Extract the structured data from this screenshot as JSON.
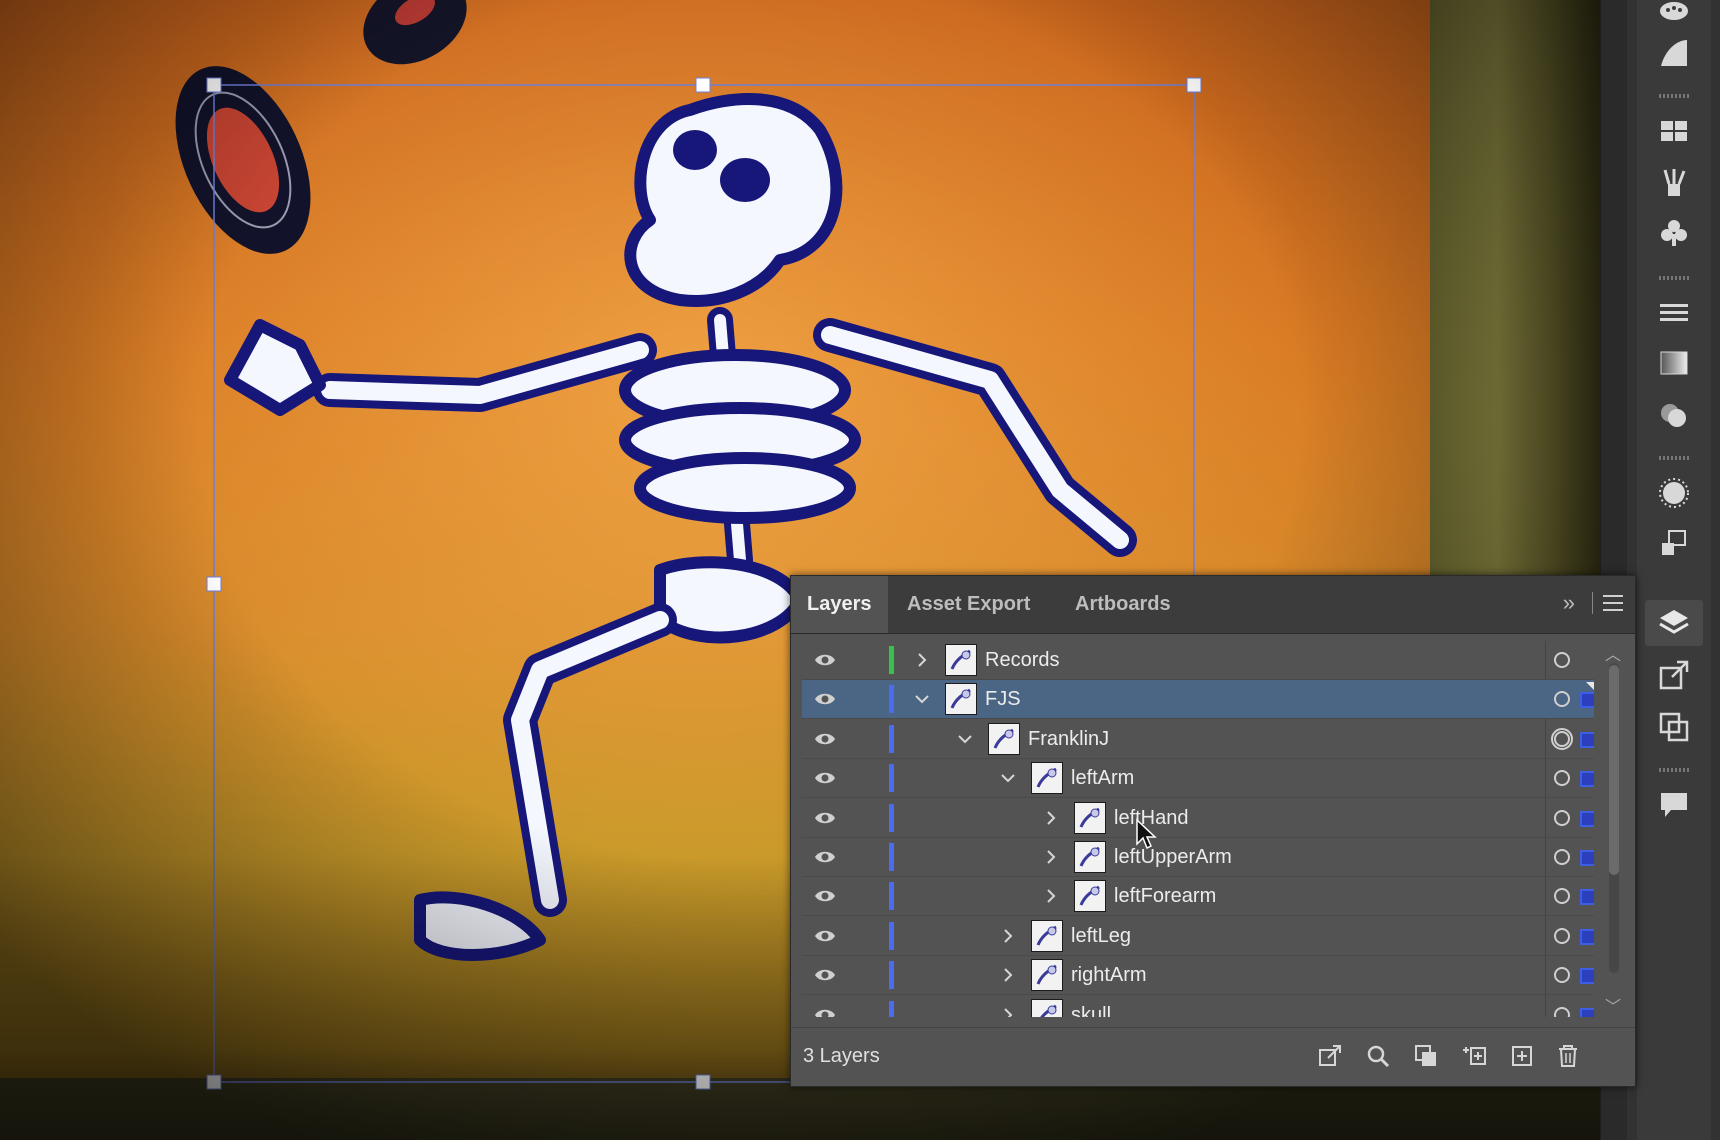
{
  "panel": {
    "tabs": [
      {
        "label": "Layers",
        "active": true
      },
      {
        "label": "Asset Export",
        "active": false
      },
      {
        "label": "Artboards",
        "active": false
      }
    ],
    "collapse_label": "»",
    "layers": [
      {
        "name": "Records",
        "depth": 0,
        "expanded": false,
        "selected": false,
        "color": "#35c34b"
      },
      {
        "name": "FJS",
        "depth": 0,
        "expanded": true,
        "selected": true,
        "color": "#4c6cf0"
      },
      {
        "name": "FranklinJ",
        "depth": 1,
        "expanded": true,
        "selected": false,
        "color": "#4c6cf0"
      },
      {
        "name": "leftArm",
        "depth": 2,
        "expanded": true,
        "selected": false,
        "color": "#4c6cf0"
      },
      {
        "name": "leftHand",
        "depth": 3,
        "expanded": false,
        "selected": false,
        "color": "#4c6cf0"
      },
      {
        "name": "leftUpperArm",
        "depth": 3,
        "expanded": false,
        "selected": false,
        "color": "#4c6cf0"
      },
      {
        "name": "leftForearm",
        "depth": 3,
        "expanded": false,
        "selected": false,
        "color": "#4c6cf0"
      },
      {
        "name": "leftLeg",
        "depth": 2,
        "expanded": false,
        "selected": false,
        "color": "#4c6cf0"
      },
      {
        "name": "rightArm",
        "depth": 2,
        "expanded": false,
        "selected": false,
        "color": "#4c6cf0"
      },
      {
        "name": "skull",
        "depth": 2,
        "expanded": false,
        "selected": false,
        "color": "#4c6cf0"
      }
    ],
    "footer": {
      "count_label": "3 Layers"
    }
  },
  "toolstrip": {
    "icons": [
      "color-guide-icon",
      "gradient-icon",
      "swatches-icon",
      "brushes-icon",
      "symbols-icon",
      "stroke-icon",
      "transparency-icon",
      "appearance-icon",
      "graphic-styles-icon",
      "align-icon",
      "layers-icon",
      "export-icon",
      "artboards-panel-icon",
      "comments-icon"
    ]
  },
  "colors": {
    "selection": "#4b6584",
    "accent": "#3d5fe6"
  }
}
